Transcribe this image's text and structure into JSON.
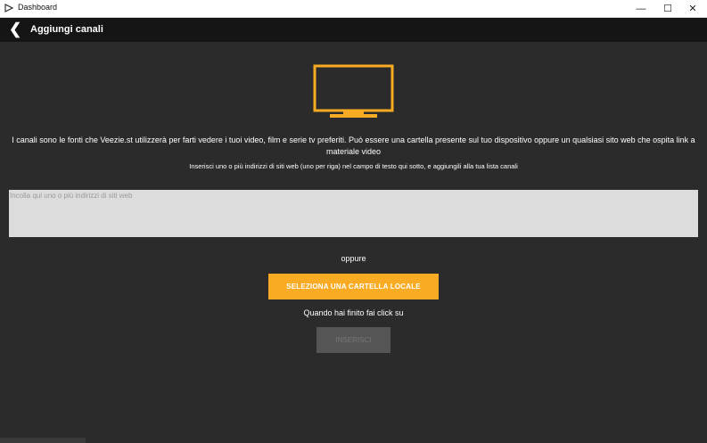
{
  "window": {
    "title": "Dashboard",
    "controls": {
      "minimize": "—",
      "maximize": "☐",
      "close": "✕"
    }
  },
  "header": {
    "back_icon": "chevron-left-icon",
    "back_glyph": "❮",
    "title": "Aggiungi canali"
  },
  "main": {
    "illustration": "tv-icon",
    "accent_color": "#f9ab23",
    "description": "I canali sono le fonti che Veezie.st utilizzerà per farti vedere i tuoi video, film e serie tv preferiti. Può essere una cartella presente sul tuo dispositivo oppure un qualsiasi sito web che ospita link a materiale video",
    "hint": "Inserisci uno o più indirizzi di siti web (uno per riga) nel campo di testo qui sotto, e aggiungili alla tua lista canali",
    "url_input": {
      "value": "",
      "placeholder": "Incolla qui uno o più indirizzi di siti web"
    },
    "or_label": "oppure",
    "select_folder_label": "SELEZIONA UNA CARTELLA LOCALE",
    "finish_text": "Quando hai finito fai click su",
    "insert_label": "INSERISCI"
  }
}
